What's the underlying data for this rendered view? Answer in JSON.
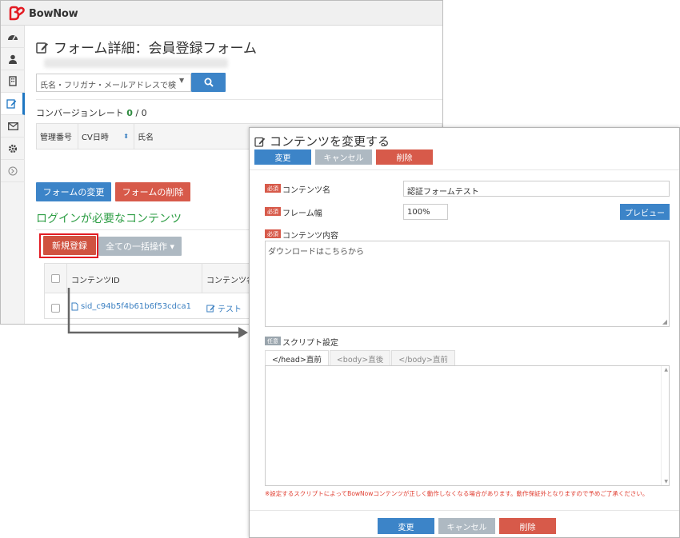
{
  "app": {
    "brand": "BowNow",
    "brand_color": "#e31b23"
  },
  "sidebar": {
    "items": [
      {
        "icon": "dashboard-icon"
      },
      {
        "icon": "user-icon"
      },
      {
        "icon": "building-icon"
      },
      {
        "icon": "edit-icon",
        "active": true
      },
      {
        "icon": "mail-icon"
      },
      {
        "icon": "gear-icon"
      },
      {
        "icon": "expand-icon"
      }
    ]
  },
  "page": {
    "title": "フォーム詳細：会員登録フォーム",
    "search_placeholder": "氏名・フリガナ・メールアドレスで検",
    "cv_label": "コンバージョンレート",
    "cv_value": "0",
    "cv_total": "/ 0",
    "table1_headers": {
      "id": "管理番号",
      "cv_date": "CV日時",
      "name": "氏名"
    },
    "btn_form_change": "フォームの変更",
    "btn_form_delete": "フォームの削除",
    "login_heading": "ログインが必要なコンテンツ",
    "btn_new": "新規登録",
    "btn_bulk": "全ての一括操作 ▾",
    "table2_headers": {
      "id": "コンテンツID",
      "name": "コンテンツ名"
    },
    "table2_row": {
      "id": "sid_c94b5f4b61b6f53cdca1",
      "name": "テスト"
    }
  },
  "modal": {
    "title": "コンテンツを変更する",
    "btn_change": "変更",
    "btn_cancel": "キャンセル",
    "btn_delete": "削除",
    "required_badge": "必須",
    "optional_badge": "任意",
    "content_name_label": "コンテンツ名",
    "content_name_value": "認証フォームテスト",
    "frame_width_label": "フレーム幅",
    "frame_width_value": "100%",
    "preview_btn": "プレビュー",
    "content_body_label": "コンテンツ内容",
    "content_body_value": "ダウンロードはこちらから",
    "script_label": "スクリプト設定",
    "tabs": [
      "</head>直前",
      "<body>直後",
      "</body>直前"
    ],
    "warning": "※設定するスクリプトによってBowNowコンテンツが正しく動作しなくなる場合があります。動作保証外となりますので予めご了承ください。"
  }
}
